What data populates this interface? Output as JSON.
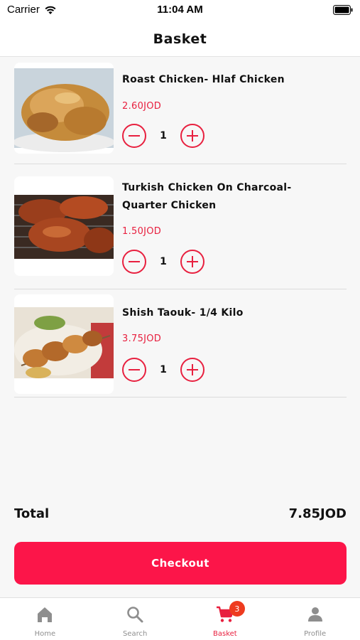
{
  "status_bar": {
    "carrier": "Carrier",
    "time": "11:04 AM"
  },
  "header": {
    "title": "Basket"
  },
  "items": [
    {
      "name": "Roast Chicken- Hlaf Chicken",
      "price": "2.60JOD",
      "quantity": "1"
    },
    {
      "name": "Turkish Chicken On Charcoal- Quarter Chicken",
      "price": "1.50JOD",
      "quantity": "1"
    },
    {
      "name": "Shish Taouk- 1/4 Kilo",
      "price": "3.75JOD",
      "quantity": "1"
    }
  ],
  "summary": {
    "total_label": "Total",
    "total_value": "7.85JOD"
  },
  "checkout_label": "Checkout",
  "tab_bar": {
    "tabs": [
      {
        "label": "Home",
        "icon": "home-icon",
        "active": false
      },
      {
        "label": "Search",
        "icon": "search-icon",
        "active": false
      },
      {
        "label": "Basket",
        "icon": "cart-icon",
        "active": true,
        "badge": "3"
      },
      {
        "label": "Profile",
        "icon": "person-icon",
        "active": false
      }
    ]
  },
  "colors": {
    "accent": "#e8203f",
    "checkout": "#fc1549",
    "badge": "#ee3b1f"
  }
}
